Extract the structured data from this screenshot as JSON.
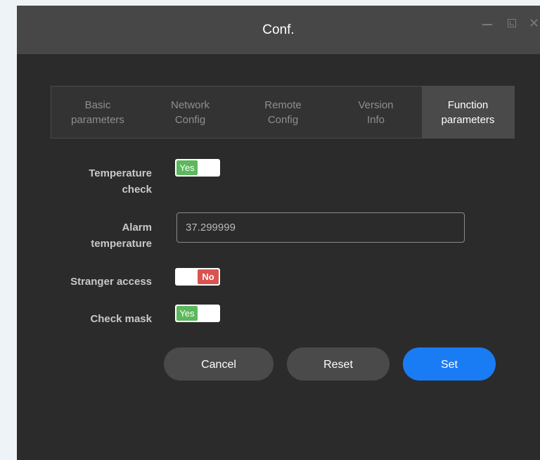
{
  "window": {
    "title": "Conf.",
    "controls": [
      "minimize-icon",
      "maximize-icon",
      "close-icon"
    ]
  },
  "tabs": [
    {
      "label": "Basic\nparameters",
      "active": false
    },
    {
      "label": "Network\nConfig",
      "active": false
    },
    {
      "label": "Remote\nConfig",
      "active": false
    },
    {
      "label": "Version\nInfo",
      "active": false
    },
    {
      "label": "Function\nparameters",
      "active": true
    }
  ],
  "form": {
    "temperature_check": {
      "label": "Temperature\ncheck",
      "toggle_text": "Yes",
      "state": "on"
    },
    "alarm_temperature": {
      "label": "Alarm\ntemperature",
      "value": "37.299999"
    },
    "stranger_access": {
      "label": "Stranger access",
      "toggle_text": "No",
      "state": "off"
    },
    "check_mask": {
      "label": "Check mask",
      "toggle_text": "Yes",
      "state": "on"
    }
  },
  "buttons": {
    "cancel": "Cancel",
    "reset": "Reset",
    "set": "Set"
  },
  "colors": {
    "accent": "#1a7cf5",
    "toggle_on": "#5cb85c",
    "toggle_off": "#d9534f",
    "background": "#2b2b2b",
    "titlebar": "#474747"
  }
}
